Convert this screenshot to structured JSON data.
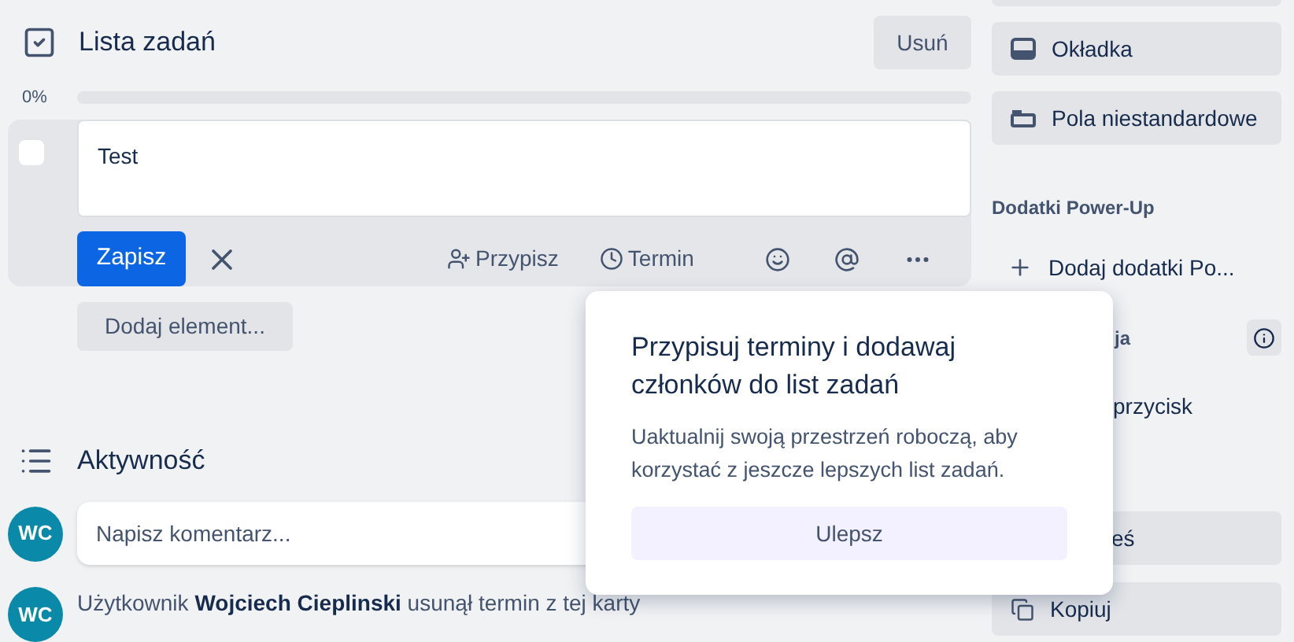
{
  "checklist": {
    "title": "Lista zadań",
    "delete_button": "Usuń",
    "progress": {
      "reading": "0%",
      "level": 0
    },
    "edit_item": {
      "checked": false,
      "value": "Test",
      "save_button": "Zapisz",
      "assign_button": "Przypisz",
      "due_button": "Termin"
    },
    "add_button": "Dodaj element..."
  },
  "activity": {
    "title": "Aktywność",
    "comment": {
      "avatar": "WC",
      "placeholder": "Napisz komentarz..."
    },
    "entries": [
      {
        "avatar": "WC",
        "text": "Użytkownik **Wojciech Cieplinski** usunął termin z tej karty"
      }
    ]
  },
  "sidebar": {
    "top_buttons": [
      {
        "label": "Okładka",
        "kind": "cover"
      },
      {
        "label": "Pola niestandardowe",
        "kind": "fields"
      }
    ],
    "powerups_title": "Dodatki Power-Up",
    "add_powerups": "Dodaj dodatki Po...",
    "automation_label": "ja",
    "automation_item": "przycisk",
    "bottom_buttons": [
      {
        "label": "eś",
        "kind": "plain"
      },
      {
        "label": "Kopiuj",
        "kind": "copy"
      }
    ]
  },
  "popover": {
    "title": "Przypisuj terminy i dodawaj członków do list zadań",
    "text": "Uaktualnij swoją przestrzeń roboczą, aby korzystać z jeszcze lepszych list zadań.",
    "button": "Ulepsz"
  }
}
